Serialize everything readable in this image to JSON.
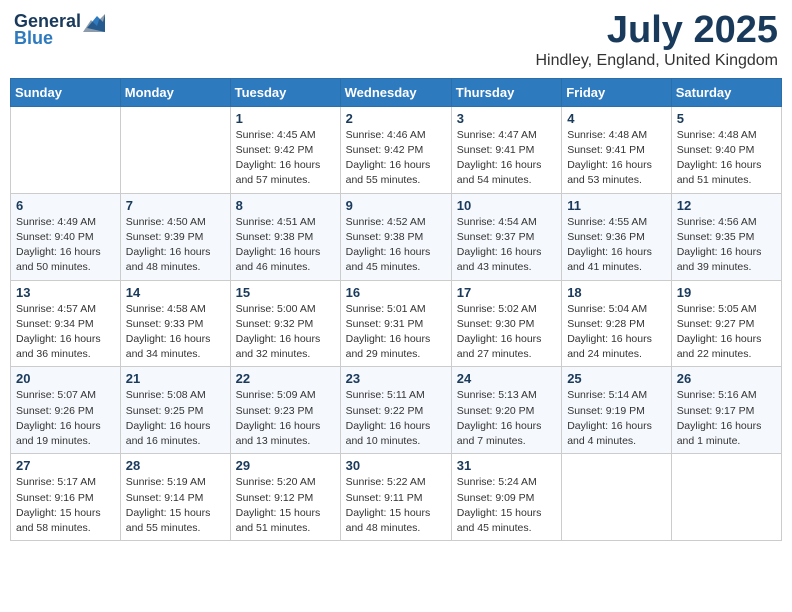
{
  "logo": {
    "general": "General",
    "blue": "Blue"
  },
  "title": "July 2025",
  "location": "Hindley, England, United Kingdom",
  "days_of_week": [
    "Sunday",
    "Monday",
    "Tuesday",
    "Wednesday",
    "Thursday",
    "Friday",
    "Saturday"
  ],
  "weeks": [
    [
      {
        "day": "",
        "info": ""
      },
      {
        "day": "",
        "info": ""
      },
      {
        "day": "1",
        "info": "Sunrise: 4:45 AM\nSunset: 9:42 PM\nDaylight: 16 hours and 57 minutes."
      },
      {
        "day": "2",
        "info": "Sunrise: 4:46 AM\nSunset: 9:42 PM\nDaylight: 16 hours and 55 minutes."
      },
      {
        "day": "3",
        "info": "Sunrise: 4:47 AM\nSunset: 9:41 PM\nDaylight: 16 hours and 54 minutes."
      },
      {
        "day": "4",
        "info": "Sunrise: 4:48 AM\nSunset: 9:41 PM\nDaylight: 16 hours and 53 minutes."
      },
      {
        "day": "5",
        "info": "Sunrise: 4:48 AM\nSunset: 9:40 PM\nDaylight: 16 hours and 51 minutes."
      }
    ],
    [
      {
        "day": "6",
        "info": "Sunrise: 4:49 AM\nSunset: 9:40 PM\nDaylight: 16 hours and 50 minutes."
      },
      {
        "day": "7",
        "info": "Sunrise: 4:50 AM\nSunset: 9:39 PM\nDaylight: 16 hours and 48 minutes."
      },
      {
        "day": "8",
        "info": "Sunrise: 4:51 AM\nSunset: 9:38 PM\nDaylight: 16 hours and 46 minutes."
      },
      {
        "day": "9",
        "info": "Sunrise: 4:52 AM\nSunset: 9:38 PM\nDaylight: 16 hours and 45 minutes."
      },
      {
        "day": "10",
        "info": "Sunrise: 4:54 AM\nSunset: 9:37 PM\nDaylight: 16 hours and 43 minutes."
      },
      {
        "day": "11",
        "info": "Sunrise: 4:55 AM\nSunset: 9:36 PM\nDaylight: 16 hours and 41 minutes."
      },
      {
        "day": "12",
        "info": "Sunrise: 4:56 AM\nSunset: 9:35 PM\nDaylight: 16 hours and 39 minutes."
      }
    ],
    [
      {
        "day": "13",
        "info": "Sunrise: 4:57 AM\nSunset: 9:34 PM\nDaylight: 16 hours and 36 minutes."
      },
      {
        "day": "14",
        "info": "Sunrise: 4:58 AM\nSunset: 9:33 PM\nDaylight: 16 hours and 34 minutes."
      },
      {
        "day": "15",
        "info": "Sunrise: 5:00 AM\nSunset: 9:32 PM\nDaylight: 16 hours and 32 minutes."
      },
      {
        "day": "16",
        "info": "Sunrise: 5:01 AM\nSunset: 9:31 PM\nDaylight: 16 hours and 29 minutes."
      },
      {
        "day": "17",
        "info": "Sunrise: 5:02 AM\nSunset: 9:30 PM\nDaylight: 16 hours and 27 minutes."
      },
      {
        "day": "18",
        "info": "Sunrise: 5:04 AM\nSunset: 9:28 PM\nDaylight: 16 hours and 24 minutes."
      },
      {
        "day": "19",
        "info": "Sunrise: 5:05 AM\nSunset: 9:27 PM\nDaylight: 16 hours and 22 minutes."
      }
    ],
    [
      {
        "day": "20",
        "info": "Sunrise: 5:07 AM\nSunset: 9:26 PM\nDaylight: 16 hours and 19 minutes."
      },
      {
        "day": "21",
        "info": "Sunrise: 5:08 AM\nSunset: 9:25 PM\nDaylight: 16 hours and 16 minutes."
      },
      {
        "day": "22",
        "info": "Sunrise: 5:09 AM\nSunset: 9:23 PM\nDaylight: 16 hours and 13 minutes."
      },
      {
        "day": "23",
        "info": "Sunrise: 5:11 AM\nSunset: 9:22 PM\nDaylight: 16 hours and 10 minutes."
      },
      {
        "day": "24",
        "info": "Sunrise: 5:13 AM\nSunset: 9:20 PM\nDaylight: 16 hours and 7 minutes."
      },
      {
        "day": "25",
        "info": "Sunrise: 5:14 AM\nSunset: 9:19 PM\nDaylight: 16 hours and 4 minutes."
      },
      {
        "day": "26",
        "info": "Sunrise: 5:16 AM\nSunset: 9:17 PM\nDaylight: 16 hours and 1 minute."
      }
    ],
    [
      {
        "day": "27",
        "info": "Sunrise: 5:17 AM\nSunset: 9:16 PM\nDaylight: 15 hours and 58 minutes."
      },
      {
        "day": "28",
        "info": "Sunrise: 5:19 AM\nSunset: 9:14 PM\nDaylight: 15 hours and 55 minutes."
      },
      {
        "day": "29",
        "info": "Sunrise: 5:20 AM\nSunset: 9:12 PM\nDaylight: 15 hours and 51 minutes."
      },
      {
        "day": "30",
        "info": "Sunrise: 5:22 AM\nSunset: 9:11 PM\nDaylight: 15 hours and 48 minutes."
      },
      {
        "day": "31",
        "info": "Sunrise: 5:24 AM\nSunset: 9:09 PM\nDaylight: 15 hours and 45 minutes."
      },
      {
        "day": "",
        "info": ""
      },
      {
        "day": "",
        "info": ""
      }
    ]
  ]
}
